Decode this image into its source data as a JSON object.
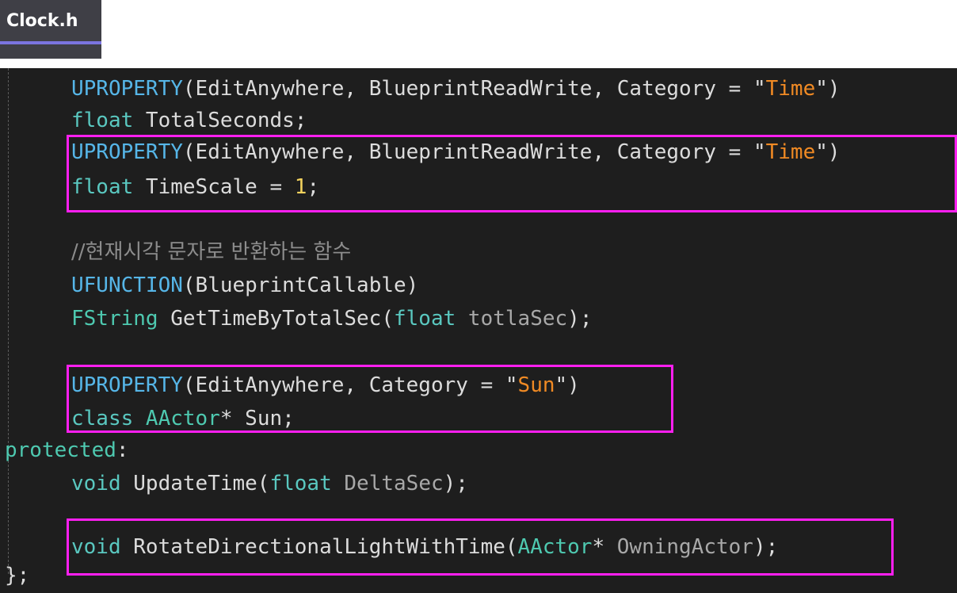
{
  "tab": {
    "label": "Clock.h"
  },
  "code": {
    "l1": {
      "macro": "UPROPERTY",
      "p1": "(EditAnywhere, BlueprintReadWrite, Category = ",
      "q1": "\"",
      "str": "Time",
      "q2": "\"",
      "end": ")"
    },
    "l2": {
      "kw": "float",
      "rest": " TotalSeconds;"
    },
    "l3": {
      "macro": "UPROPERTY",
      "p1": "(EditAnywhere, BlueprintReadWrite, Category = ",
      "q1": "\"",
      "str": "Time",
      "q2": "\"",
      "end": ")"
    },
    "l4": {
      "kw": "float",
      "mid": " TimeScale = ",
      "num": "1",
      "end": ";"
    },
    "l5": {
      "comment": "//현재시각 문자로 반환하는 함수"
    },
    "l6": {
      "macro": "UFUNCTION",
      "rest": "(BlueprintCallable)"
    },
    "l7": {
      "type": "FString",
      "mid": " GetTimeByTotalSec(",
      "kw": "float",
      "param": " totlaSec",
      "end": ");"
    },
    "l8": {
      "macro": "UPROPERTY",
      "p1": "(EditAnywhere, Category = ",
      "q1": "\"",
      "str": "Sun",
      "q2": "\"",
      "end": ")"
    },
    "l9": {
      "kw": "class",
      "type": " AActor",
      "rest": "* Sun;"
    },
    "l10": {
      "kw": "protected",
      "rest": ":"
    },
    "l11": {
      "kw": "void",
      "mid": " UpdateTime(",
      "kw2": "float",
      "param": " DeltaSec",
      "end": ");"
    },
    "l12": {
      "kw": "void",
      "mid": " RotateDirectionalLightWithTime(",
      "type": "AActor",
      "star": "*",
      "param": " OwningActor",
      "end": ");"
    },
    "l13": {
      "text": "};"
    }
  },
  "colors": {
    "highlight_box": "#ff1ff0",
    "editor_bg": "#1e1e1e",
    "string": "#f08a24",
    "number": "#f4d35e"
  }
}
